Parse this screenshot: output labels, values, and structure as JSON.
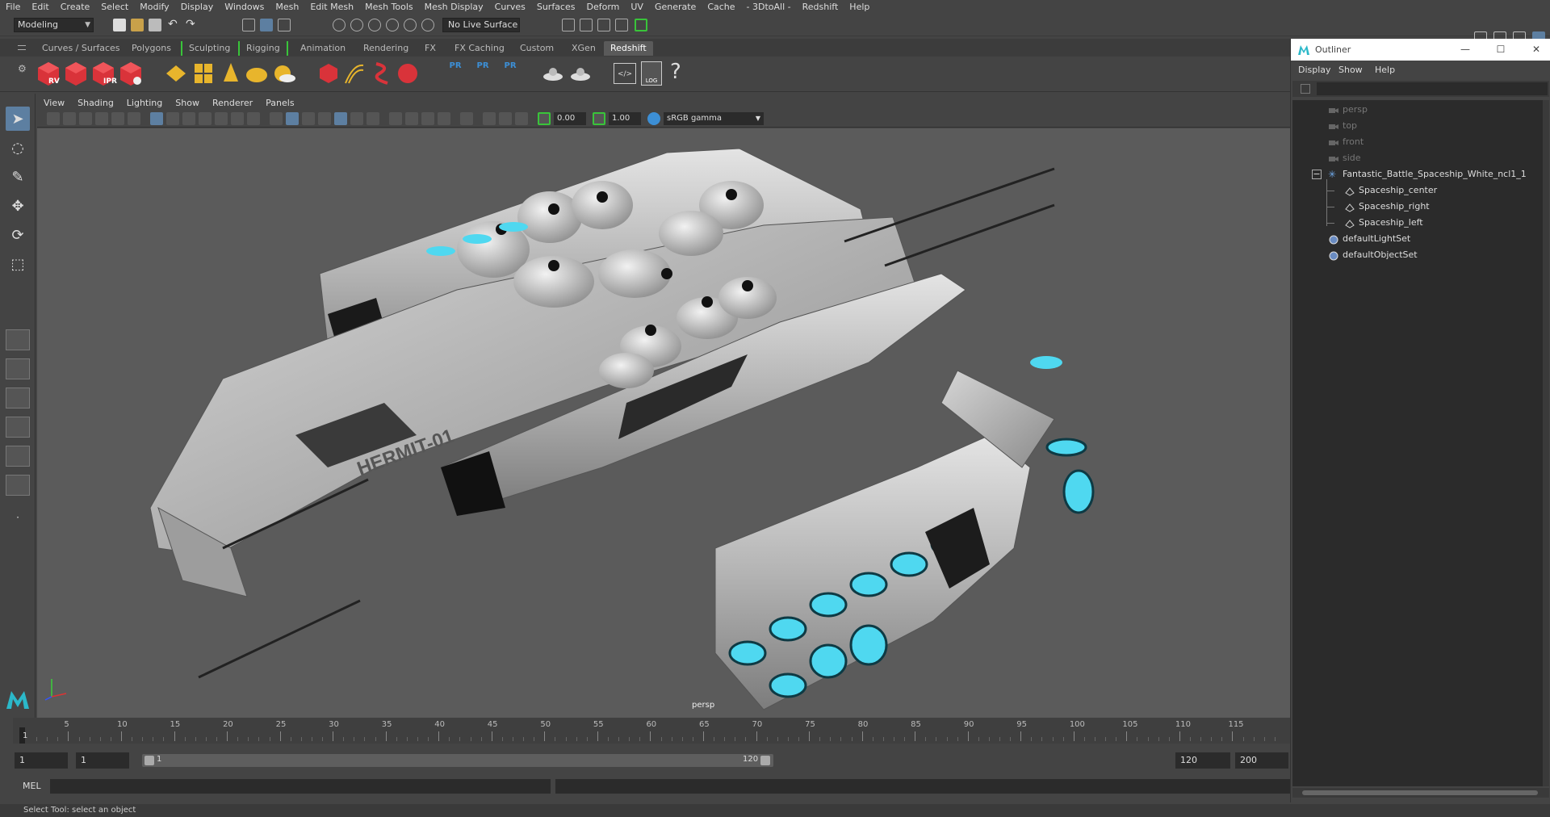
{
  "menubar": [
    "File",
    "Edit",
    "Create",
    "Select",
    "Modify",
    "Display",
    "Windows",
    "Mesh",
    "Edit Mesh",
    "Mesh Tools",
    "Mesh Display",
    "Curves",
    "Surfaces",
    "Deform",
    "UV",
    "Generate",
    "Cache",
    "- 3DtoAll -",
    "Redshift",
    "Help"
  ],
  "status_line": {
    "mode": "Modeling",
    "live_surface": "No Live Surface"
  },
  "shelf": {
    "tabs": [
      "Curves / Surfaces",
      "Polygons",
      "Sculpting",
      "Rigging",
      "Animation",
      "Rendering",
      "FX",
      "FX Caching",
      "Custom",
      "XGen",
      "Redshift"
    ],
    "active_tab": "Redshift",
    "icon_labels": [
      "RV",
      "IPR",
      "PR",
      "PR",
      "PR",
      "LOG",
      "?"
    ]
  },
  "panel": {
    "menu": [
      "View",
      "Shading",
      "Lighting",
      "Show",
      "Renderer",
      "Panels"
    ],
    "exposure": "0.00",
    "gamma": "1.00",
    "color_space": "sRGB gamma",
    "camera_label": "persp"
  },
  "timeline": {
    "ticks": [
      "5",
      "10",
      "15",
      "20",
      "25",
      "30",
      "35",
      "40",
      "45",
      "50",
      "55",
      "60",
      "65",
      "70",
      "75",
      "80",
      "85",
      "90",
      "95",
      "100",
      "105",
      "110",
      "115"
    ],
    "current_frame": "1"
  },
  "range": {
    "start": "1",
    "playback_start": "1",
    "slider_start": "1",
    "slider_end": "120",
    "playback_end": "120",
    "end": "200"
  },
  "command_line": {
    "label": "MEL"
  },
  "help_line": "Select Tool: select an object",
  "outliner": {
    "title": "Outliner",
    "menu": [
      "Display",
      "Show",
      "Help"
    ],
    "items": [
      {
        "label": "persp",
        "type": "camera"
      },
      {
        "label": "top",
        "type": "camera"
      },
      {
        "label": "front",
        "type": "camera"
      },
      {
        "label": "side",
        "type": "camera"
      },
      {
        "label": "Fantastic_Battle_Spaceship_White_ncl1_1",
        "type": "group"
      },
      {
        "label": "Spaceship_center",
        "type": "mesh"
      },
      {
        "label": "Spaceship_right",
        "type": "mesh"
      },
      {
        "label": "Spaceship_left",
        "type": "mesh"
      },
      {
        "label": "defaultLightSet",
        "type": "set"
      },
      {
        "label": "defaultObjectSet",
        "type": "set"
      }
    ]
  },
  "model_text": "HERMIT-01",
  "colors": {
    "accent_blue": "#5d7fa1",
    "shelf_red": "#d9333a",
    "shelf_yellow": "#e8b52c",
    "shelf_blue": "#3c8fd6",
    "glow_cyan": "#4fd8f0",
    "hull": "#b8b8b8"
  }
}
